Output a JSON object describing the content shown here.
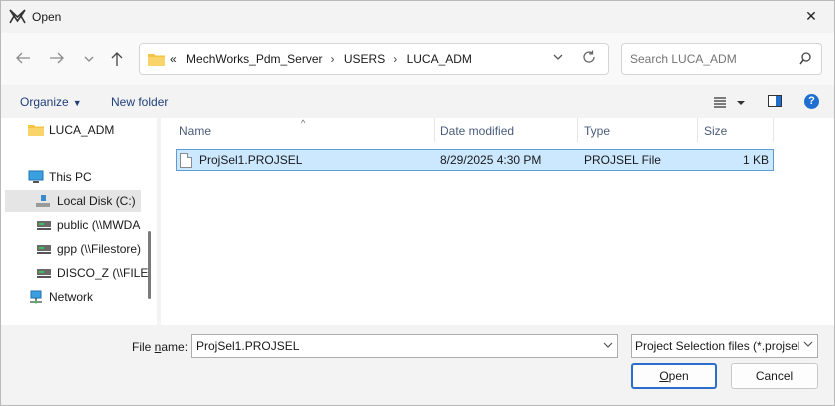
{
  "window": {
    "title": "Open",
    "close_glyph": "✕"
  },
  "address": {
    "overflow": "«",
    "crumbs": [
      "MechWorks_Pdm_Server",
      "USERS",
      "LUCA_ADM"
    ],
    "separator": "›"
  },
  "search": {
    "placeholder": "Search LUCA_ADM"
  },
  "toolbar": {
    "organize": "Organize",
    "new_folder": "New folder",
    "help": "?"
  },
  "nav": {
    "items": [
      {
        "label": "LUCA_ADM",
        "icon": "folder-icon"
      },
      {
        "label": "This PC",
        "icon": "computer-icon"
      },
      {
        "label": "Local Disk (C:)",
        "icon": "drive-icon"
      },
      {
        "label": "public (\\\\MWDA",
        "icon": "network-drive-icon"
      },
      {
        "label": "gpp (\\\\Filestore)",
        "icon": "network-drive-icon"
      },
      {
        "label": "DISCO_Z (\\\\FILE",
        "icon": "network-drive-icon"
      },
      {
        "label": "Network",
        "icon": "network-icon"
      }
    ]
  },
  "files": {
    "columns": [
      "Name",
      "Date modified",
      "Type",
      "Size"
    ],
    "rows": [
      {
        "name": "ProjSel1.PROJSEL",
        "date": "8/29/2025 4:30 PM",
        "type": "PROJSEL File",
        "size": "1 KB"
      }
    ]
  },
  "bottom": {
    "file_name_label_pre": "File ",
    "file_name_label_u": "n",
    "file_name_label_post": "ame:",
    "file_name_value": "ProjSel1.PROJSEL",
    "file_type_value": "Project Selection files (*.projsel)",
    "open_label_u": "O",
    "open_label_rest": "pen",
    "cancel_label": "Cancel"
  },
  "colors": {
    "accent": "#1f6fd0",
    "selection_bg": "#cce8ff",
    "selection_border": "#5a9bd8"
  }
}
